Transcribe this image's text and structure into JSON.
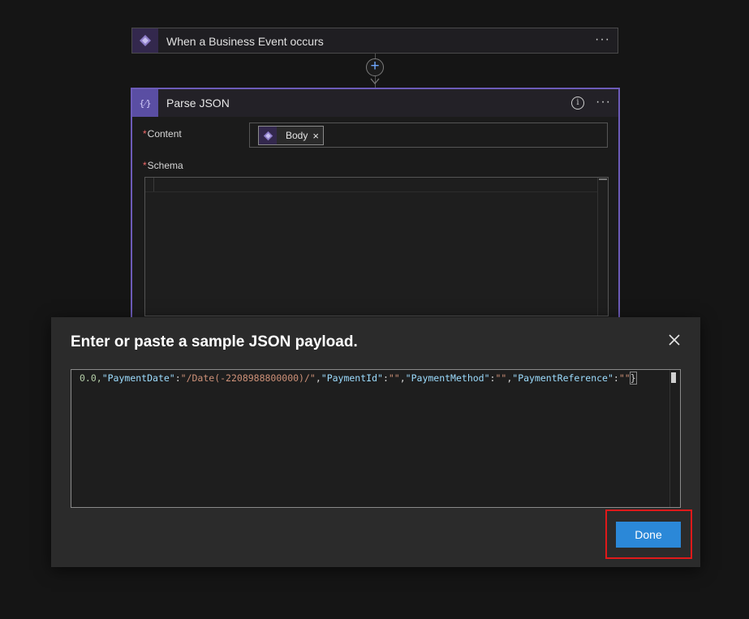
{
  "trigger": {
    "title": "When a Business Event occurs",
    "icon": "business-event-icon",
    "more_label": "···"
  },
  "connector": {
    "add_label": "+"
  },
  "parse_json": {
    "title": "Parse JSON",
    "icon_text": "{⁄}",
    "info_label": "i",
    "more_label": "···",
    "content_label": "Content",
    "required_mark": "*",
    "content_token": {
      "label": "Body",
      "close": "×"
    },
    "schema_label": "Schema"
  },
  "dialog": {
    "title": "Enter or paste a sample JSON payload.",
    "code": {
      "seg0": "0.0,",
      "seg1": "\"PaymentDate\"",
      "seg2": ":",
      "seg3": "\"/Date(-2208988800000)/\"",
      "seg4": ",",
      "seg5": "\"PaymentId\"",
      "seg6": ":",
      "seg7": "\"\"",
      "seg8": ",",
      "seg9": "\"PaymentMethod\"",
      "seg10": ":",
      "seg11": "\"\"",
      "seg12": ",",
      "seg13": "\"PaymentReference\"",
      "seg14": ":",
      "seg15": "\"\"",
      "seg16": "}"
    },
    "done_label": "Done"
  },
  "colors": {
    "accent_purple": "#6c5bb8",
    "done_blue": "#2b88d8",
    "highlight_red": "#e0191a",
    "json_key": "#9cdcfe",
    "json_string": "#ce9178",
    "json_number": "#b5cea8"
  }
}
